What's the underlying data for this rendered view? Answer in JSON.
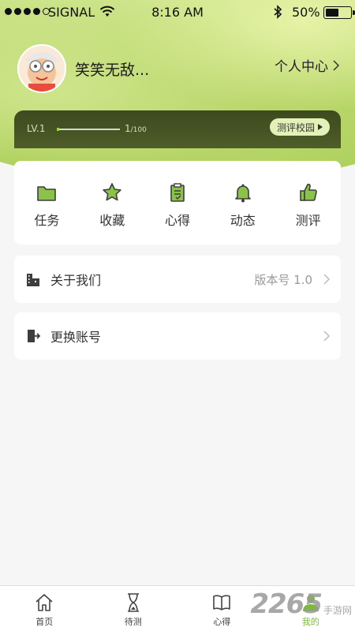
{
  "status_bar": {
    "carrier": "SIGNAL",
    "time": "8:16 AM",
    "battery": "50%"
  },
  "profile": {
    "username": "笑笑无敌...",
    "center_link": "个人中心"
  },
  "level": {
    "label": "LV.1",
    "count": "1",
    "total": "/100",
    "progress_fraction": 0.01,
    "campus_button": "测评校园"
  },
  "grid": [
    {
      "label": "任务",
      "icon": "folder-icon"
    },
    {
      "label": "收藏",
      "icon": "star-icon"
    },
    {
      "label": "心得",
      "icon": "clipboard-icon"
    },
    {
      "label": "动态",
      "icon": "bell-icon"
    },
    {
      "label": "测评",
      "icon": "thumbs-up-icon"
    }
  ],
  "rows": {
    "about": {
      "label": "关于我们",
      "value": "版本号 1.0"
    },
    "switch": {
      "label": "更换账号"
    }
  },
  "tabs": [
    {
      "label": "首页",
      "icon": "home-icon"
    },
    {
      "label": "待测",
      "icon": "hourglass-icon"
    },
    {
      "label": "心得",
      "icon": "book-icon"
    },
    {
      "label": "我的",
      "icon": "person-icon"
    }
  ],
  "watermark": {
    "number": "2265",
    "site": "手游网"
  },
  "colors": {
    "accent": "#7cba3a",
    "level_bar": "#44521f"
  }
}
